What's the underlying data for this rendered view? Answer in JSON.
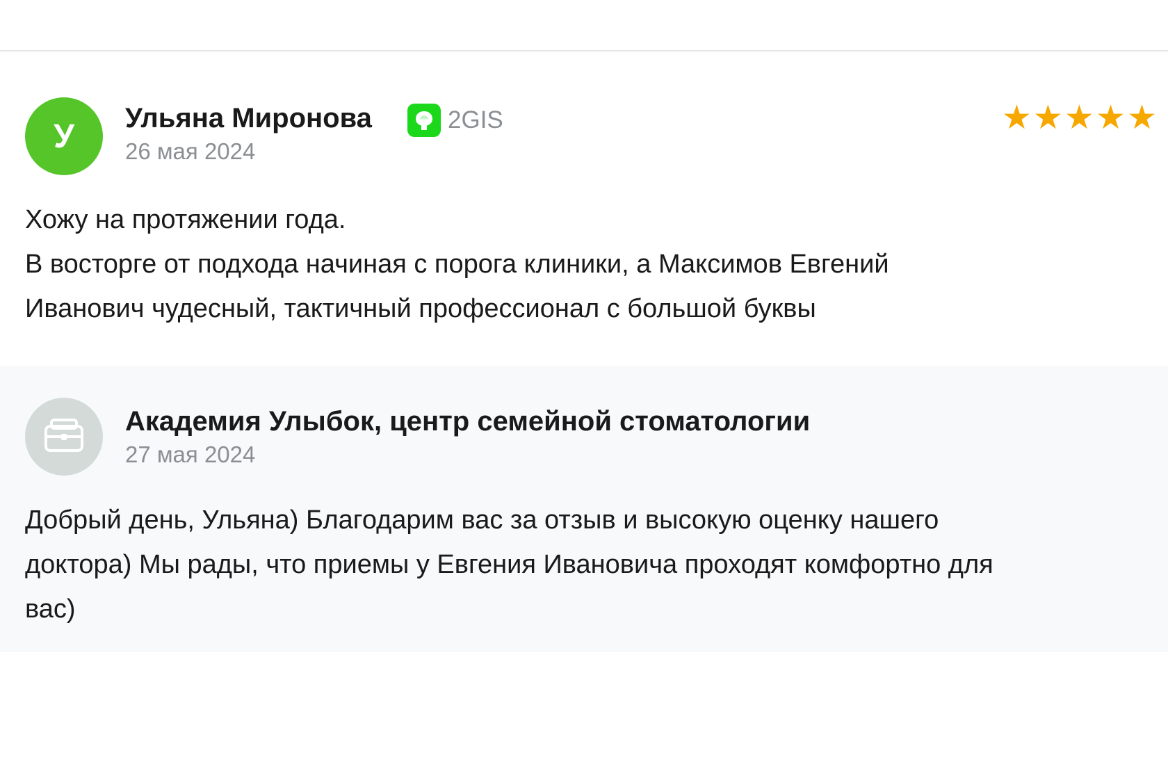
{
  "review": {
    "avatar_letter": "У",
    "author_name": "Ульяна Миронова",
    "source_label": "2GIS",
    "source_icon": "2gis-logo-icon",
    "date": "26 мая 2024",
    "rating": 5,
    "rating_max": 5,
    "star_glyph": "★",
    "text_lines": [
      "Хожу на протяжении года.",
      "В восторге от подхода начиная с порога клиники, а Максимов Евгений",
      "Иванович чудесный, тактичный профессионал с большой буквы"
    ]
  },
  "reply": {
    "avatar_icon": "briefcase-icon",
    "author_name": "Академия Улыбок, центр семейной стоматологии",
    "date": "27 мая 2024",
    "text_lines": [
      "Добрый день, Ульяна) Благодарим вас за отзыв и высокую оценку нашего",
      "доктора) Мы рады, что приемы у Евгения Ивановича проходят комфортно для",
      "вас)"
    ]
  },
  "colors": {
    "avatar_green": "#55c52a",
    "source_green": "#1bd81b",
    "star": "#f6a800",
    "muted_text": "#8a8f93",
    "reply_background": "#f7f9fb",
    "reply_avatar": "#d3dad7"
  }
}
